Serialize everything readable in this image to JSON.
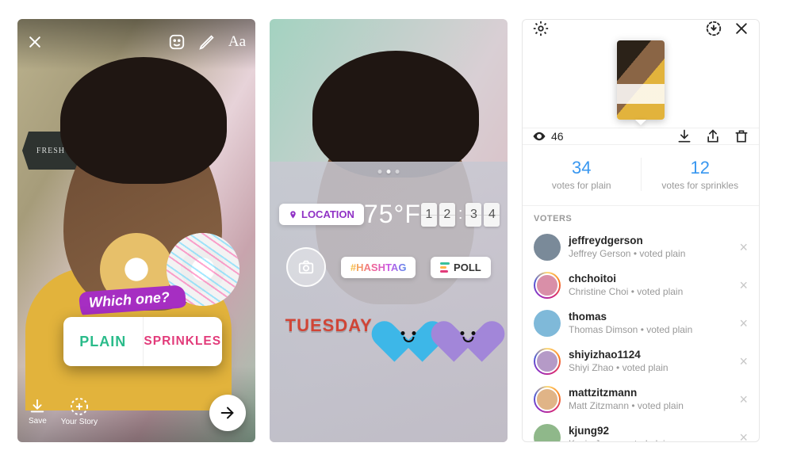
{
  "panel1": {
    "sign": "FRESH PIES",
    "question": "Which one?",
    "option_a": "PLAIN",
    "option_b": "SPRINKLES",
    "save_label": "Save",
    "your_story_label": "Your Story",
    "text_tool": "Aa"
  },
  "panel2": {
    "location_label": "LOCATION",
    "temperature": "75°F",
    "clock_digits": [
      "1",
      "2",
      "3",
      "4"
    ],
    "hashtag_label": "#HASHTAG",
    "poll_label": "POLL",
    "day_label": "TUESDAY"
  },
  "panel3": {
    "view_count": "46",
    "results": {
      "a_count": "34",
      "a_label": "votes for plain",
      "b_count": "12",
      "b_label": "votes for sprinkles"
    },
    "voters_header": "VOTERS",
    "voters": [
      {
        "username": "jeffreydgerson",
        "name": "Jeffrey Gerson",
        "vote": "voted plain",
        "color": "#7a8a99",
        "ring": false
      },
      {
        "username": "chchoitoi",
        "name": "Christine Choi",
        "vote": "voted plain",
        "color": "#d98fa8",
        "ring": true
      },
      {
        "username": "thomas",
        "name": "Thomas Dimson",
        "vote": "voted plain",
        "color": "#7fb9d9",
        "ring": false
      },
      {
        "username": "shiyizhao1124",
        "name": "Shiyi Zhao",
        "vote": "voted plain",
        "color": "#b59ac7",
        "ring": true
      },
      {
        "username": "mattzitzmann",
        "name": "Matt Zitzmann",
        "vote": "voted plain",
        "color": "#e0b487",
        "ring": true
      },
      {
        "username": "kjung92",
        "name": "Kevin Jung",
        "vote": "voted plain",
        "color": "#8fb88a",
        "ring": false
      }
    ]
  }
}
